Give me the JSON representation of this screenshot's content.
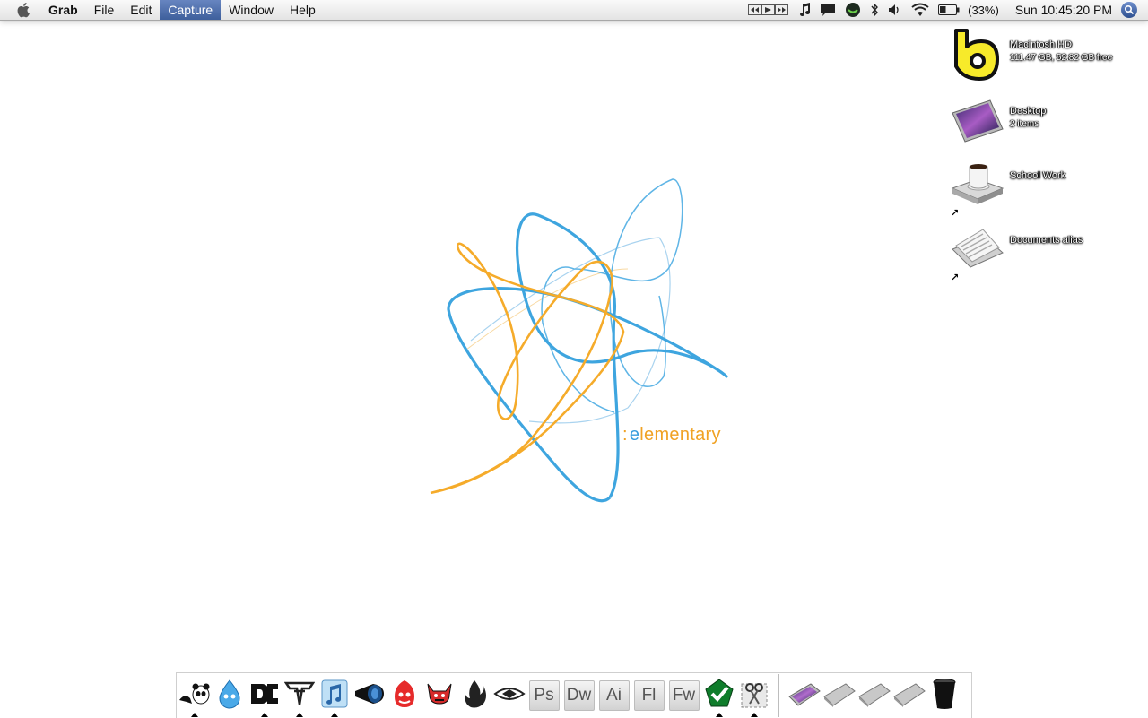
{
  "menubar": {
    "app_name": "Grab",
    "menus": [
      "File",
      "Edit",
      "Capture",
      "Window",
      "Help"
    ],
    "active_menu": "Capture",
    "status": {
      "battery_percent": "(33%)",
      "clock": "Sun 10:45:20 PM"
    }
  },
  "desktop": {
    "icons": [
      {
        "label": "Macintosh HD",
        "sub": "111.47 GB, 52.82 GB free"
      },
      {
        "label": "Desktop",
        "sub": "2 items"
      },
      {
        "label": "School Work",
        "sub": ""
      },
      {
        "label": "Documents alias",
        "sub": ""
      }
    ]
  },
  "wallpaper": {
    "colon": ":",
    "brand_first": "e",
    "brand_rest": "lementary"
  },
  "dock": {
    "apps": [
      {
        "icon": "panda-icon"
      },
      {
        "icon": "water-drop-icon"
      },
      {
        "icon": "dc-logo-icon"
      },
      {
        "icon": "fallen-logo-icon"
      },
      {
        "icon": "itunes-icon"
      },
      {
        "icon": "camera-lens-icon"
      },
      {
        "icon": "spitfire-icon"
      },
      {
        "icon": "toy-machine-icon"
      },
      {
        "icon": "flame-icon"
      },
      {
        "icon": "eye-logo-icon"
      },
      {
        "icon": "photoshop-icon",
        "text": "Ps"
      },
      {
        "icon": "dreamweaver-icon",
        "text": "Dw"
      },
      {
        "icon": "illustrator-icon",
        "text": "Ai"
      },
      {
        "icon": "flash-icon",
        "text": "Fl"
      },
      {
        "icon": "fireworks-icon",
        "text": "Fw"
      },
      {
        "icon": "checkmark-icon"
      },
      {
        "icon": "grab-scissors-icon"
      }
    ],
    "stacks": [
      {
        "icon": "desktop-stack-icon"
      },
      {
        "icon": "folder-stack-icon"
      },
      {
        "icon": "folder-stack-icon"
      },
      {
        "icon": "folder-stack-icon"
      },
      {
        "icon": "trash-icon"
      }
    ]
  }
}
